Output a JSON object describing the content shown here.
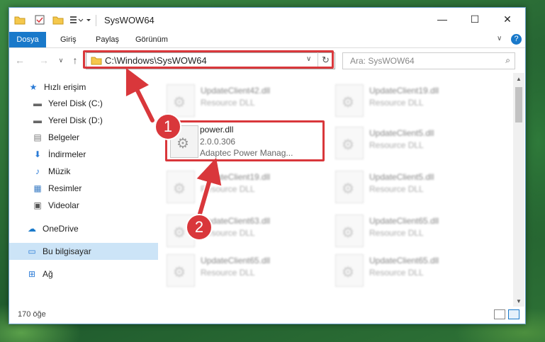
{
  "window": {
    "title": "SysWOW64",
    "minimize": "—",
    "maximize": "☐",
    "close": "✕"
  },
  "ribbon": {
    "tabs": [
      "Dosya",
      "Giriş",
      "Paylaş",
      "Görünüm"
    ]
  },
  "nav": {
    "address": "C:\\Windows\\SysWOW64",
    "search_placeholder": "Ara: SysWOW64"
  },
  "sidebar": {
    "items": [
      {
        "label": "Hızlı erişim",
        "icon": "star-icon"
      },
      {
        "label": "Yerel Disk (C:)",
        "icon": "drive-icon"
      },
      {
        "label": "Yerel Disk (D:)",
        "icon": "drive-icon"
      },
      {
        "label": "Belgeler",
        "icon": "documents-icon"
      },
      {
        "label": "İndirmeler",
        "icon": "download-icon"
      },
      {
        "label": "Müzik",
        "icon": "music-icon"
      },
      {
        "label": "Resimler",
        "icon": "pictures-icon"
      },
      {
        "label": "Videolar",
        "icon": "videos-icon"
      },
      {
        "label": "OneDrive",
        "icon": "cloud-icon"
      },
      {
        "label": "Bu bilgisayar",
        "icon": "computer-icon"
      },
      {
        "label": "Ağ",
        "icon": "network-icon"
      }
    ]
  },
  "files": {
    "focus": {
      "name": "power.dll",
      "version": "2.0.0.306",
      "description": "Adaptec Power Manag..."
    },
    "background": [
      {
        "name": "UpdateClient42.dll",
        "sub": "Resource DLL"
      },
      {
        "name": "UpdateClient19.dll",
        "sub": "Resource DLL"
      },
      {
        "name": "UpdateClient5.dll",
        "sub": "Resource DLL"
      },
      {
        "name": "UpdateClient19.dll",
        "sub": "Resource DLL"
      },
      {
        "name": "UpdateClient5.dll",
        "sub": "Resource DLL"
      },
      {
        "name": "UpdateClient63.dll",
        "sub": "Resource DLL"
      },
      {
        "name": "UpdateClient65.dll",
        "sub": "Resource DLL"
      },
      {
        "name": "UpdateClient65.dll",
        "sub": "Resource DLL"
      },
      {
        "name": "UpdateClient65.dll",
        "sub": "Resource DLL"
      }
    ]
  },
  "status": {
    "count": "170 öğe"
  },
  "annotations": {
    "step1": "1",
    "step2": "2"
  },
  "colors": {
    "accent": "#1979ca",
    "highlight": "#d9373b"
  }
}
